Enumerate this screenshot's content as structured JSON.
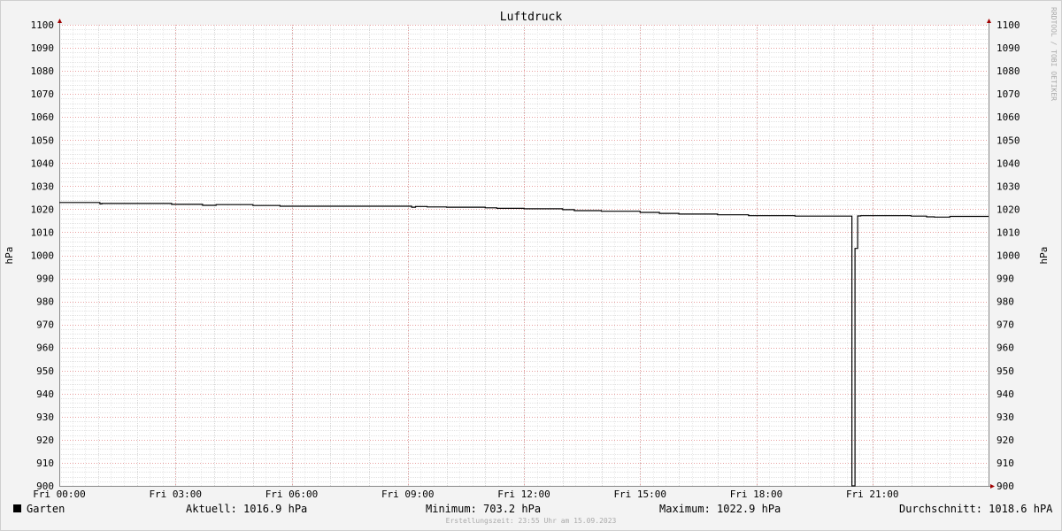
{
  "chart_data": {
    "type": "line",
    "title": "Luftdruck",
    "ylabel_left": "hPa",
    "ylabel_right": "hPa",
    "ylim": [
      900,
      1100
    ],
    "y_ticks": [
      900,
      910,
      920,
      930,
      940,
      950,
      960,
      970,
      980,
      990,
      1000,
      1010,
      1020,
      1030,
      1040,
      1050,
      1060,
      1070,
      1080,
      1090,
      1100
    ],
    "xlim_hours": [
      0,
      24
    ],
    "x_tick_labels": [
      "Fri 00:00",
      "Fri 03:00",
      "Fri 06:00",
      "Fri 09:00",
      "Fri 12:00",
      "Fri 15:00",
      "Fri 18:00",
      "Fri 21:00"
    ],
    "x_tick_hours": [
      0,
      3,
      6,
      9,
      12,
      15,
      18,
      21
    ],
    "grid": true,
    "series": [
      {
        "name": "Garten",
        "color": "#000000",
        "x_hours": [
          0,
          1.0,
          1.05,
          1.1,
          2.9,
          3.7,
          4.05,
          5.0,
          5.7,
          7.0,
          8.5,
          9.1,
          9.2,
          9.5,
          10.0,
          11.0,
          11.3,
          12.0,
          13.0,
          13.3,
          14.0,
          15.0,
          15.5,
          16.0,
          17.0,
          17.8,
          19.0,
          20.45,
          20.47,
          20.53,
          20.55,
          20.6,
          20.62,
          20.7,
          21.0,
          22.0,
          22.4,
          22.6,
          23.0,
          24.0
        ],
        "values": [
          1022.9,
          1022.9,
          1022.3,
          1022.5,
          1022.1,
          1021.7,
          1022.0,
          1021.6,
          1021.3,
          1021.3,
          1021.3,
          1020.9,
          1021.2,
          1021.0,
          1020.9,
          1020.6,
          1020.4,
          1020.2,
          1019.8,
          1019.4,
          1019.1,
          1018.6,
          1018.2,
          1017.9,
          1017.6,
          1017.2,
          1017.0,
          1017.0,
          900.0,
          900.0,
          1003.0,
          1003.0,
          1017.1,
          1017.2,
          1017.2,
          1017.0,
          1016.7,
          1016.6,
          1016.9,
          1016.9
        ]
      }
    ]
  },
  "legend": {
    "series_name": "Garten",
    "current": "Aktuell: 1016.9 hPa",
    "minimum": "Minimum: 703.2 hPa",
    "maximum": "Maximum: 1022.9 hPa",
    "average": "Durchschnitt: 1018.6 hPA"
  },
  "footer": "Erstellungszeit: 23:55 Uhr am 15.09.2023",
  "vendor_text": "RRDTOOL / TOBI OETIKER"
}
